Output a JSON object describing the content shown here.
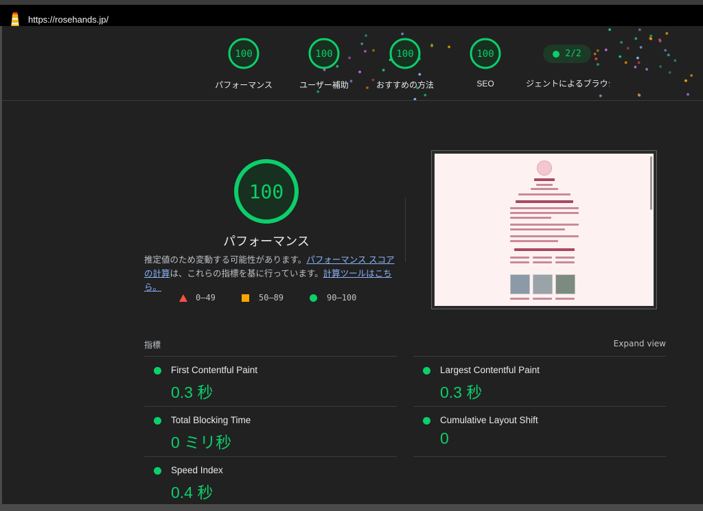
{
  "browser": {
    "url": "https://rosehands.jp/"
  },
  "header": {
    "categories": [
      {
        "label": "パフォーマンス",
        "score": "100"
      },
      {
        "label": "ユーザー補助",
        "score": "100"
      },
      {
        "label": "おすすめの方法",
        "score": "100"
      },
      {
        "label": "SEO",
        "score": "100"
      }
    ],
    "pwa": {
      "value": "2/2",
      "label": "ジェントによるブラウジ"
    }
  },
  "performance": {
    "score": "100",
    "title": "パフォーマンス",
    "desc_prefix": "推定値のため変動する可能性があります。",
    "desc_link1": "パフォーマンス スコアの計算",
    "desc_middle": "は、これらの指標を基に行っています。",
    "desc_link2": "計算ツールはこちら。"
  },
  "legend": {
    "fail": "0–49",
    "average": "50–89",
    "pass": "90–100"
  },
  "metrics": {
    "heading": "指標",
    "expand_label": "Expand view",
    "items": [
      {
        "name": "First Contentful Paint",
        "value": "0.3 秒"
      },
      {
        "name": "Largest Contentful Paint",
        "value": "0.3 秒"
      },
      {
        "name": "Total Blocking Time",
        "value": "0 ミリ秒"
      },
      {
        "name": "Cumulative Layout Shift",
        "value": "0"
      },
      {
        "name": "Speed Index",
        "value": "0.4 秒"
      }
    ]
  },
  "colors": {
    "pass": "#0cce6b",
    "average": "#ffa400",
    "fail": "#ff4e42",
    "link": "#8ab4f8",
    "background": "#212121"
  }
}
